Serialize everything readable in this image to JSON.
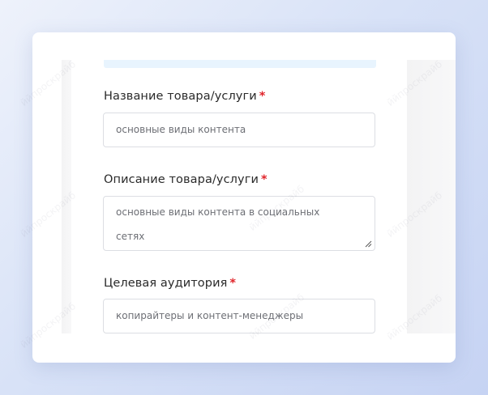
{
  "form": {
    "product_name": {
      "label": "Название товара/услуги",
      "required_mark": "*",
      "value": "основные виды контента"
    },
    "product_description": {
      "label": "Описание товара/услуги",
      "required_mark": "*",
      "value": "основные виды контента в социальных сетях"
    },
    "target_audience": {
      "label": "Целевая аудитория",
      "required_mark": "*",
      "value": "копирайтеры и контент-менеджеры"
    }
  },
  "colors": {
    "required": "#e0242a",
    "background_gradient_end": "#c6d3f3",
    "info_bar": "#e8f4fe"
  }
}
